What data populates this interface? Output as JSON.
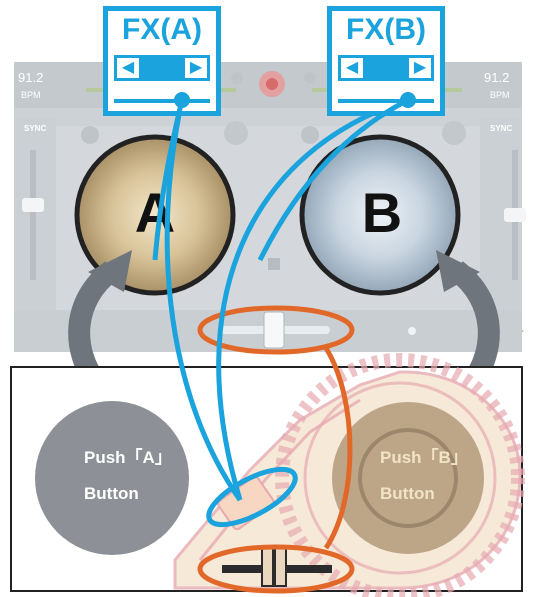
{
  "fx_a": {
    "title": "FX(A)"
  },
  "fx_b": {
    "title": "FX(B)"
  },
  "app": {
    "bpm_left": "91.2",
    "bpm_right": "91.2",
    "bpm_unit_left": "BPM",
    "bpm_unit_right": "BPM",
    "sync_left": "SYNC",
    "sync_right": "SYNC",
    "deck_a_letter": "A",
    "deck_b_letter": "B"
  },
  "controller": {
    "push_a_line1": "Push「A」",
    "push_a_line2": "Button",
    "push_b_line1": "Push「B」",
    "push_b_line2": "Button"
  },
  "colors": {
    "fx_blue": "#1aa3dc",
    "highlight_orange": "#e2682a",
    "arrow_gray": "#6e757c",
    "button_a_gray": "#8d9197",
    "button_b_tan": "#b39a7a"
  }
}
